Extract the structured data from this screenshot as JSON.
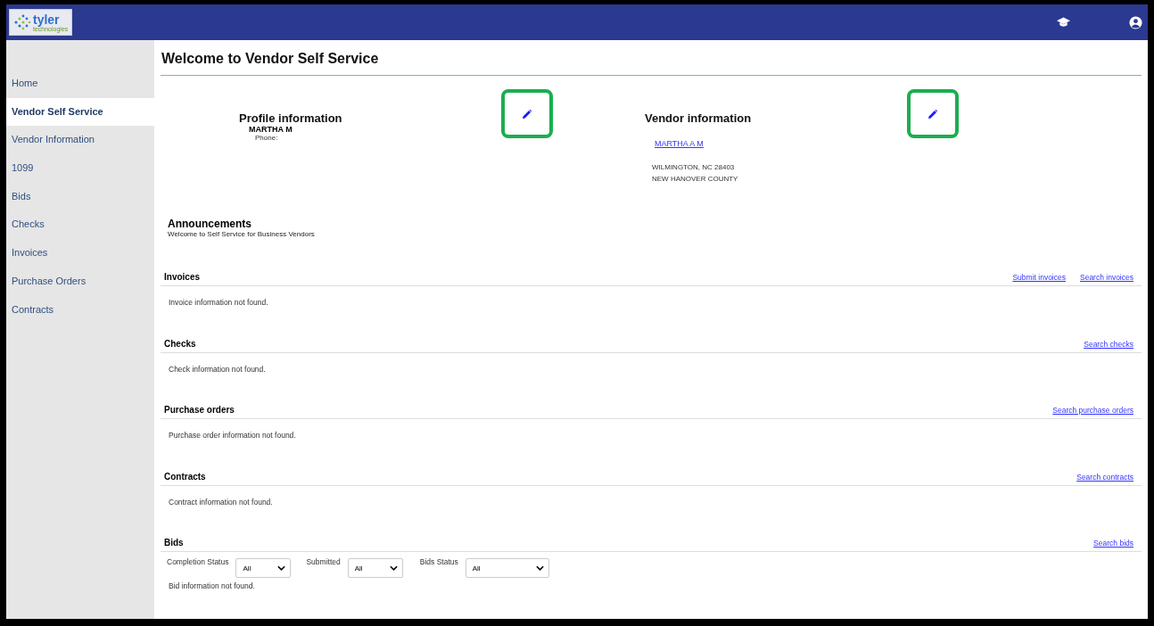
{
  "header": {
    "logo_text": "tyler",
    "logo_subtext": "technologies"
  },
  "sidebar": {
    "items": [
      {
        "label": "Home",
        "selected": false
      },
      {
        "label": "Vendor Self Service",
        "selected": true
      },
      {
        "label": "Vendor Information",
        "selected": false
      },
      {
        "label": "1099",
        "selected": false
      },
      {
        "label": "Bids",
        "selected": false
      },
      {
        "label": "Checks",
        "selected": false
      },
      {
        "label": "Invoices",
        "selected": false
      },
      {
        "label": "Purchase Orders",
        "selected": false
      },
      {
        "label": "Contracts",
        "selected": false
      }
    ]
  },
  "page_title": "Welcome to Vendor Self Service",
  "profile": {
    "title": "Profile information",
    "name": "MARTHA M",
    "phone_label": "Phone:",
    "edit_highlighted": true
  },
  "vendor": {
    "title": "Vendor information",
    "name_link": "MARTHA A M",
    "address_lines": [
      "WILMINGTON, NC 28403",
      "NEW HANOVER COUNTY"
    ],
    "edit_highlighted": true
  },
  "announcements": {
    "title": "Announcements",
    "message": "Welcome to Self Service for Business Vendors"
  },
  "sections": [
    {
      "title": "Invoices",
      "links": [
        "Submit invoices",
        "Search invoices"
      ],
      "message": "Invoice information not found."
    },
    {
      "title": "Checks",
      "links": [
        "Search checks"
      ],
      "message": "Check information not found."
    },
    {
      "title": "Purchase orders",
      "links": [
        "Search purchase orders"
      ],
      "message": "Purchase order information not found."
    },
    {
      "title": "Contracts",
      "links": [
        "Search contracts"
      ],
      "message": "Contract information not found."
    },
    {
      "title": "Bids",
      "links": [
        "Search bids"
      ],
      "filters": [
        {
          "label": "Completion Status",
          "value": "All"
        },
        {
          "label": "Submitted",
          "value": "All"
        },
        {
          "label": "Bids Status",
          "value": "All"
        }
      ],
      "message": "Bid information not found."
    }
  ]
}
